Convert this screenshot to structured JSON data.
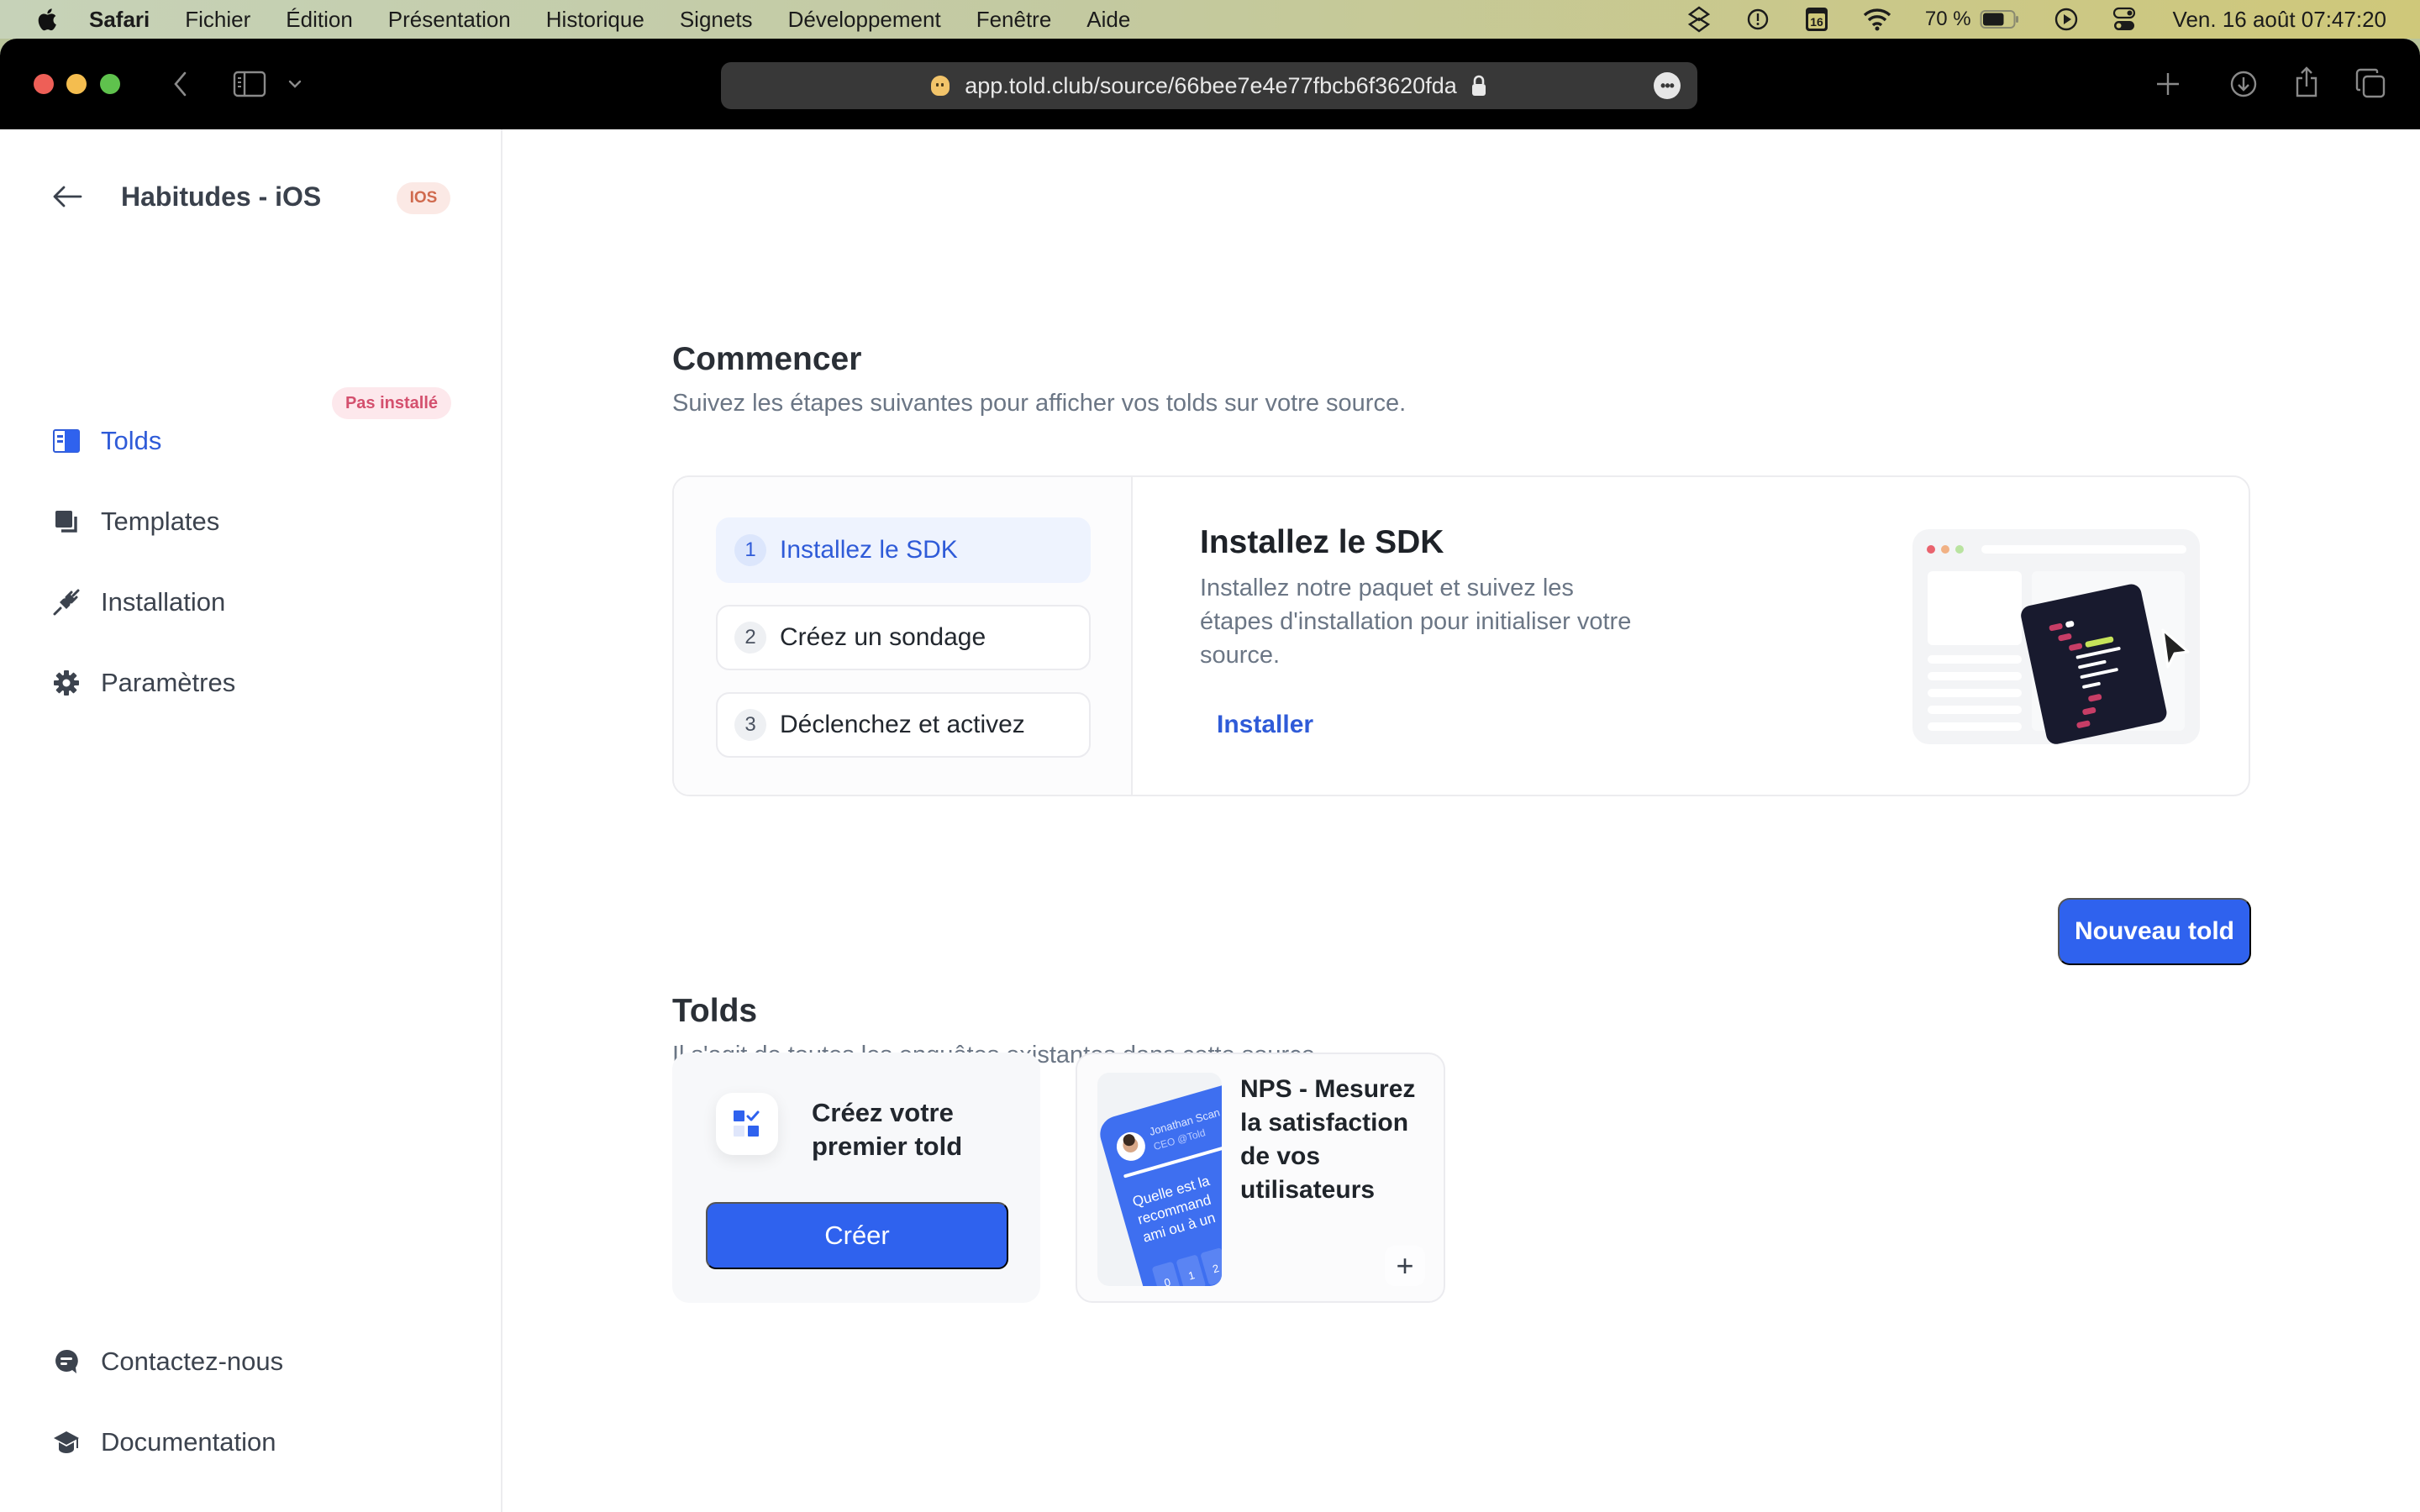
{
  "menubar": {
    "app_name": "Safari",
    "menus": [
      "Fichier",
      "Édition",
      "Présentation",
      "Historique",
      "Signets",
      "Développement",
      "Fenêtre",
      "Aide"
    ],
    "status": {
      "icons": [
        "layers-icon",
        "time-machine-icon",
        "calendar-icon",
        "wifi-icon",
        "battery-icon",
        "play-icon",
        "control-center-icon"
      ],
      "calendar_day": "16",
      "battery_percent": "70 %",
      "battery_level": 0.7,
      "clock": "Ven. 16 août  07:47:20"
    }
  },
  "browser": {
    "url": "app.told.club/source/66bee7e4e77fbcb6f3620fda",
    "more_label": "•••"
  },
  "sidebar": {
    "title": "Habitudes - iOS",
    "platform_badge": "IOS",
    "nav": [
      {
        "label": "Tolds",
        "icon": "tolds-icon",
        "active": true
      },
      {
        "label": "Templates",
        "icon": "templates-icon",
        "active": false
      },
      {
        "label": "Installation",
        "icon": "plug-icon",
        "active": false,
        "badge": "Pas installé"
      },
      {
        "label": "Paramètres",
        "icon": "gear-icon",
        "active": false
      }
    ],
    "footer": [
      {
        "label": "Contactez-nous",
        "icon": "chat-icon"
      },
      {
        "label": "Documentation",
        "icon": "graduation-cap-icon"
      }
    ]
  },
  "getting_started": {
    "title": "Commencer",
    "subtitle": "Suivez les étapes suivantes pour afficher vos tolds sur votre source.",
    "steps": [
      {
        "number": "1",
        "label": "Installez le SDK",
        "active": true
      },
      {
        "number": "2",
        "label": "Créez un sondage",
        "active": false
      },
      {
        "number": "3",
        "label": "Déclenchez et activez",
        "active": false
      }
    ],
    "detail": {
      "title": "Installez le SDK",
      "description": "Installez notre paquet et suivez les étapes d'installation pour initialiser votre source.",
      "action": "Installer"
    }
  },
  "tolds": {
    "title": "Tolds",
    "subtitle": "Il s'agit de toutes les enquêtes existantes dans cette source.",
    "new_button": "Nouveau told",
    "create_card": {
      "title": "Créez votre premier told",
      "button": "Créer"
    },
    "templates": [
      {
        "title": "NPS - Mesurez la satisfaction de vos utilisateurs",
        "preview": {
          "author": "Jonathan Scan",
          "role": "CEO @Told",
          "question": "Quelle est la recommand ami ou à un",
          "scale": [
            "0",
            "1",
            "2"
          ]
        },
        "add_label": "+"
      }
    ]
  },
  "colors": {
    "accent": "#2f62ee",
    "accent_text": "#2f5bd8",
    "badge_ios_bg": "#fbe9e5",
    "badge_ios_text": "#d06a4e",
    "badge_warning_bg": "#fde8ec",
    "badge_warning_text": "#d4506e"
  }
}
